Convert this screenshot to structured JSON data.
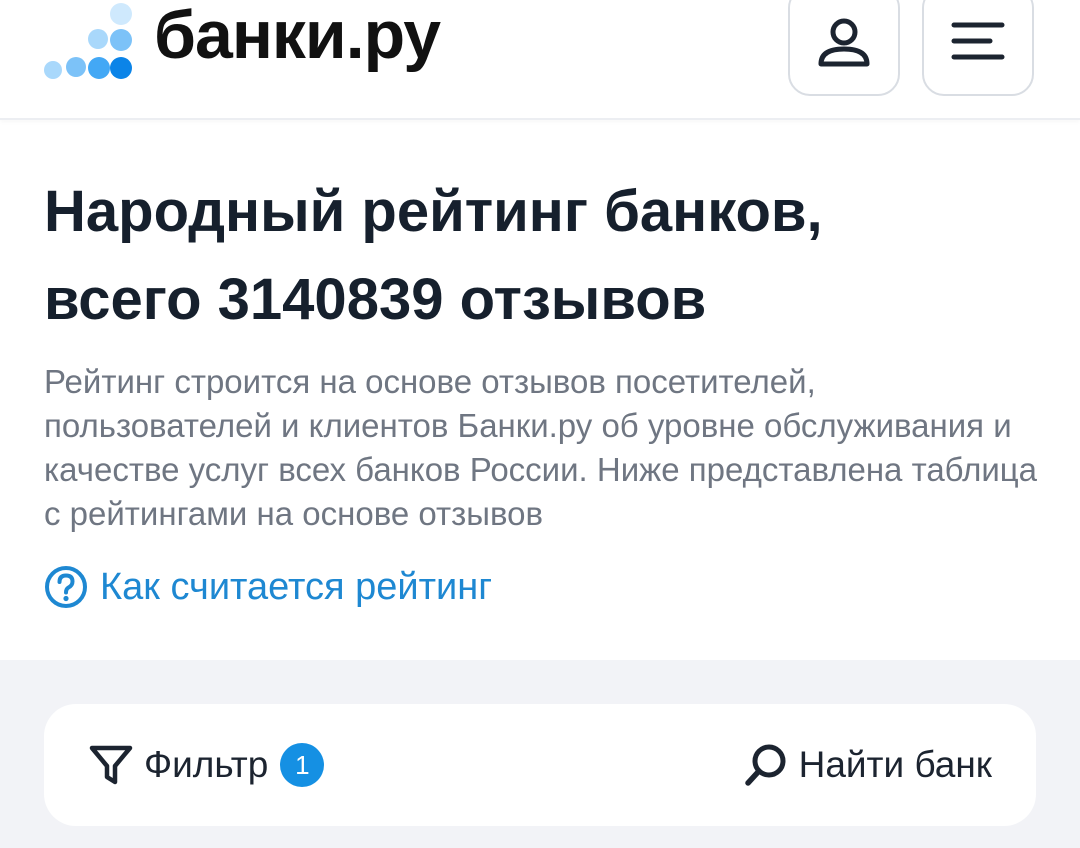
{
  "header": {
    "logo_text": "банки.ру",
    "logo_icon": "dots-logo-icon",
    "profile_icon": "user-icon",
    "menu_icon": "hamburger-menu-icon"
  },
  "main": {
    "title_line1": "Народный рейтинг банков,",
    "title_line2": "всего 3140839 отзывов",
    "description": "Рейтинг строится на основе отзывов посетителей, пользователей и клиентов Банки.ру об уровне обслуживания и качестве услуг всех банков России. Ниже представлена таблица с рейтингами на основе отзывов",
    "how_link": {
      "label": "Как считается рейтинг",
      "icon": "question-circle-icon"
    }
  },
  "toolbar": {
    "filter_label": "Фильтр",
    "filter_count": "1",
    "filter_icon": "funnel-icon",
    "search_label": "Найти банк",
    "search_icon": "search-icon"
  },
  "colors": {
    "accent": "#1e88d2",
    "badge": "#1590e3",
    "title": "#16202d",
    "muted_text": "#6f7682",
    "background_gray": "#f2f3f7",
    "logo_dark": "#0b84e8",
    "logo_mid": "#43a8f5",
    "logo_light": "#a9d8fb"
  }
}
